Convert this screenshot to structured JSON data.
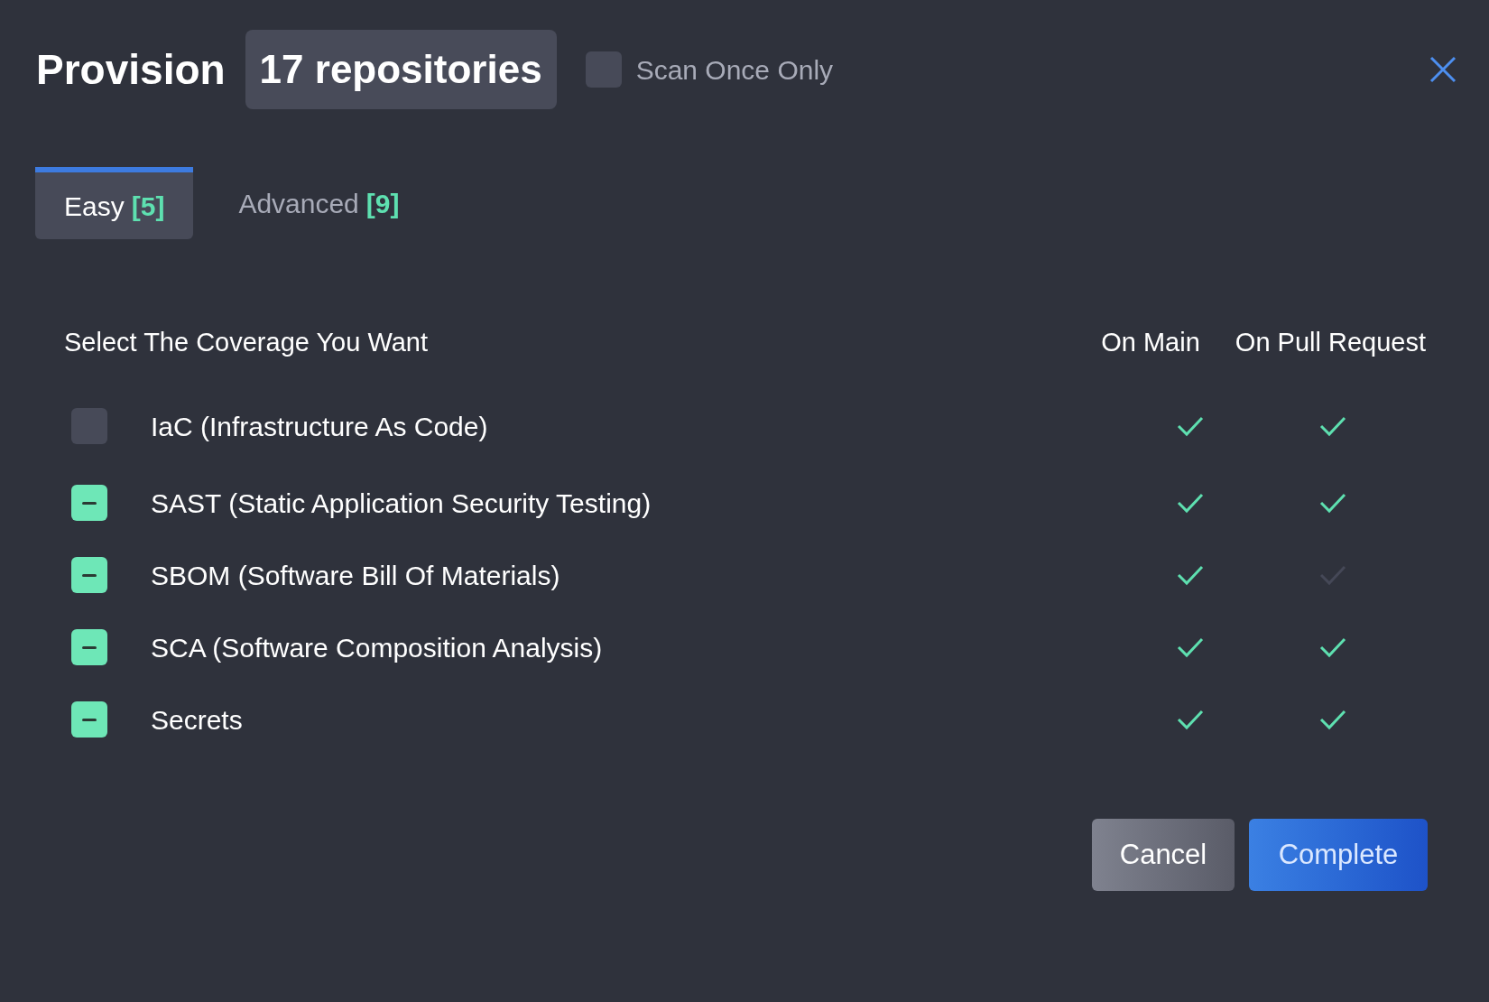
{
  "header": {
    "title": "Provision",
    "count_badge": "17 repositories",
    "scan_once": {
      "label": "Scan Once Only",
      "checked": false
    }
  },
  "tabs": [
    {
      "label": "Easy",
      "count": "[5]",
      "selected": true
    },
    {
      "label": "Advanced",
      "count": "[9]",
      "selected": false
    }
  ],
  "coverage": {
    "heading": "Select The Coverage You Want",
    "columns": [
      "On Main",
      "On Pull Request"
    ],
    "rows": [
      {
        "label": "IaC (Infrastructure As Code)",
        "checked": false,
        "on_main": true,
        "on_pull_request": true
      },
      {
        "label": "SAST (Static Application Security Testing)",
        "checked": true,
        "on_main": true,
        "on_pull_request": true
      },
      {
        "label": "SBOM (Software Bill Of Materials)",
        "checked": true,
        "on_main": true,
        "on_pull_request": false
      },
      {
        "label": "SCA (Software Composition Analysis)",
        "checked": true,
        "on_main": true,
        "on_pull_request": true
      },
      {
        "label": "Secrets",
        "checked": true,
        "on_main": true,
        "on_pull_request": true
      }
    ]
  },
  "buttons": [
    {
      "label": "Cancel",
      "kind": "secondary"
    },
    {
      "label": "Complete",
      "kind": "primary"
    }
  ]
}
